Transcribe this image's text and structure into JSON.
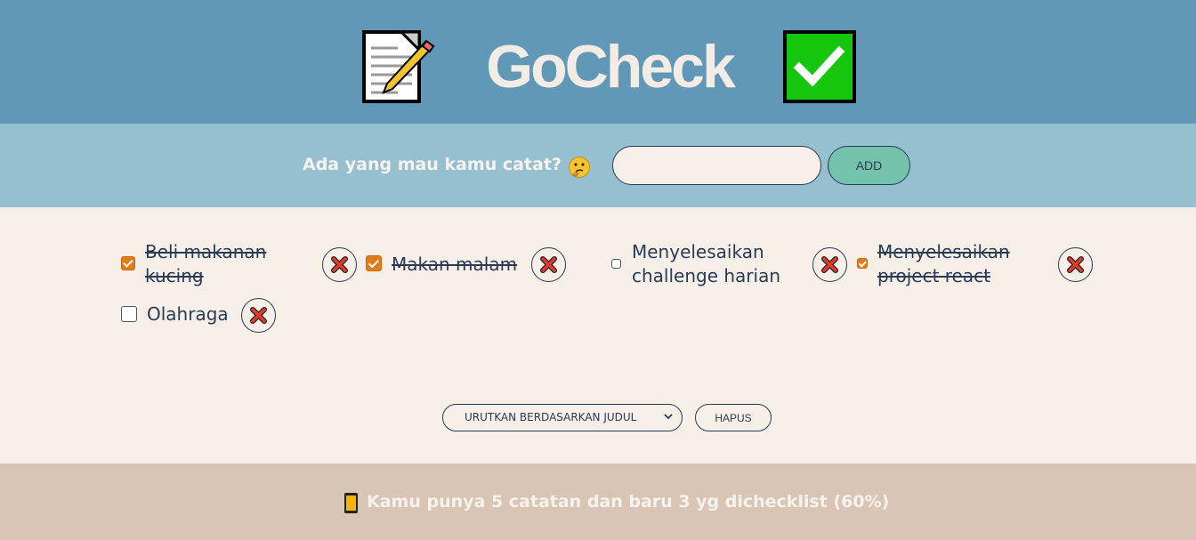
{
  "header": {
    "title": "GoCheck",
    "left_icon": "memo-icon",
    "right_icon": "check-mark-icon"
  },
  "form": {
    "prompt": "Ada yang mau kamu catat?",
    "prompt_icon": "thinking-face-icon",
    "input_value": "",
    "input_placeholder": "",
    "add_label": "ADD"
  },
  "todos": [
    {
      "text": "Beli makanan kucing",
      "done": true
    },
    {
      "text": "Makan malam",
      "done": true
    },
    {
      "text": "Menyelesaikan challenge harian",
      "done": false
    },
    {
      "text": "Menyelesaikan project react",
      "done": true
    },
    {
      "text": "Olahraga",
      "done": false
    }
  ],
  "controls": {
    "sort_selected": "URUTKAN BERDASARKAN JUDUL",
    "hapus_label": "HAPUS"
  },
  "footer": {
    "stats_text": "Kamu punya 5 catatan dan baru 3 yg dichecklist (60%)",
    "icon": "mobile-phone-icon"
  },
  "colors": {
    "header_bg": "#6198b8",
    "form_bg": "#96bfd0",
    "main_bg": "#f5efe8",
    "footer_bg": "#d8c5b6",
    "accent": "#74c2ac",
    "checkbox": "#e07c1b"
  }
}
